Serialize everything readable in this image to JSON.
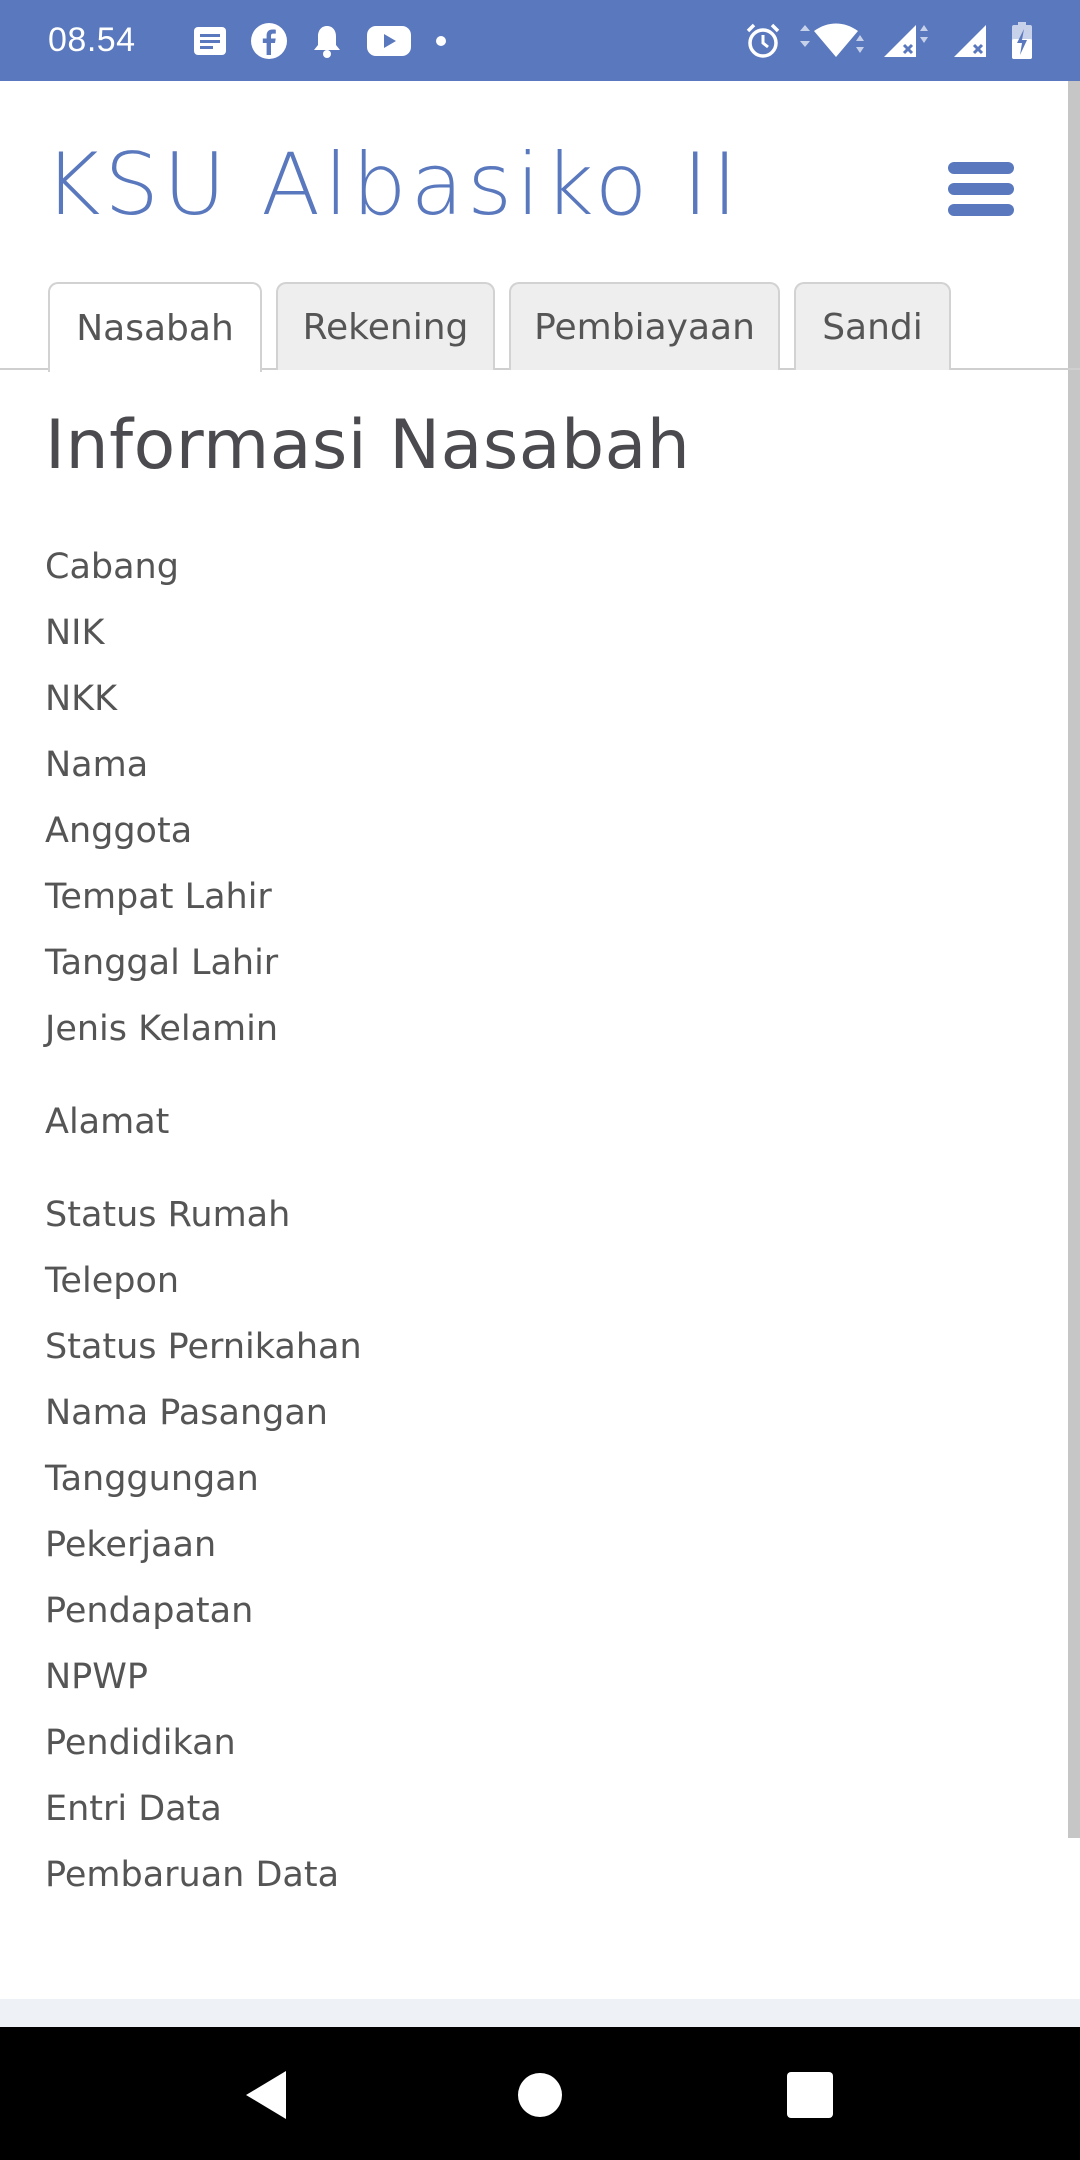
{
  "status_bar": {
    "time": "08.54",
    "left_icons": [
      "notes-icon",
      "facebook-icon",
      "bell-icon",
      "youtube-icon",
      "dot-icon"
    ],
    "right_icons": [
      "alarm-icon",
      "wifi-icon",
      "signal-1-icon",
      "signal-2-icon",
      "battery-charging-icon"
    ]
  },
  "header": {
    "brand": "KSU Albasiko II",
    "menu_icon": "hamburger-menu-icon"
  },
  "tabs": [
    {
      "label": "Nasabah",
      "active": true
    },
    {
      "label": "Rekening",
      "active": false
    },
    {
      "label": "Pembiayaan",
      "active": false
    },
    {
      "label": "Sandi",
      "active": false
    }
  ],
  "main": {
    "title": "Informasi Nasabah",
    "fields": [
      "Cabang",
      "NIK",
      "NKK",
      "Nama",
      "Anggota",
      "Tempat Lahir",
      "Tanggal Lahir",
      "Jenis Kelamin",
      "Alamat",
      "Status Rumah",
      "Telepon",
      "Status Pernikahan",
      "Nama Pasangan",
      "Tanggungan",
      "Pekerjaan",
      "Pendapatan",
      "NPWP",
      "Pendidikan",
      "Entri Data",
      "Pembaruan Data"
    ]
  },
  "nav_bar": {
    "buttons": [
      "back-icon",
      "home-icon",
      "recents-icon"
    ]
  },
  "colors": {
    "accent": "#5a78bd",
    "text": "#555555",
    "title": "#4b4b4f",
    "tab_inactive": "#eeeeee"
  }
}
